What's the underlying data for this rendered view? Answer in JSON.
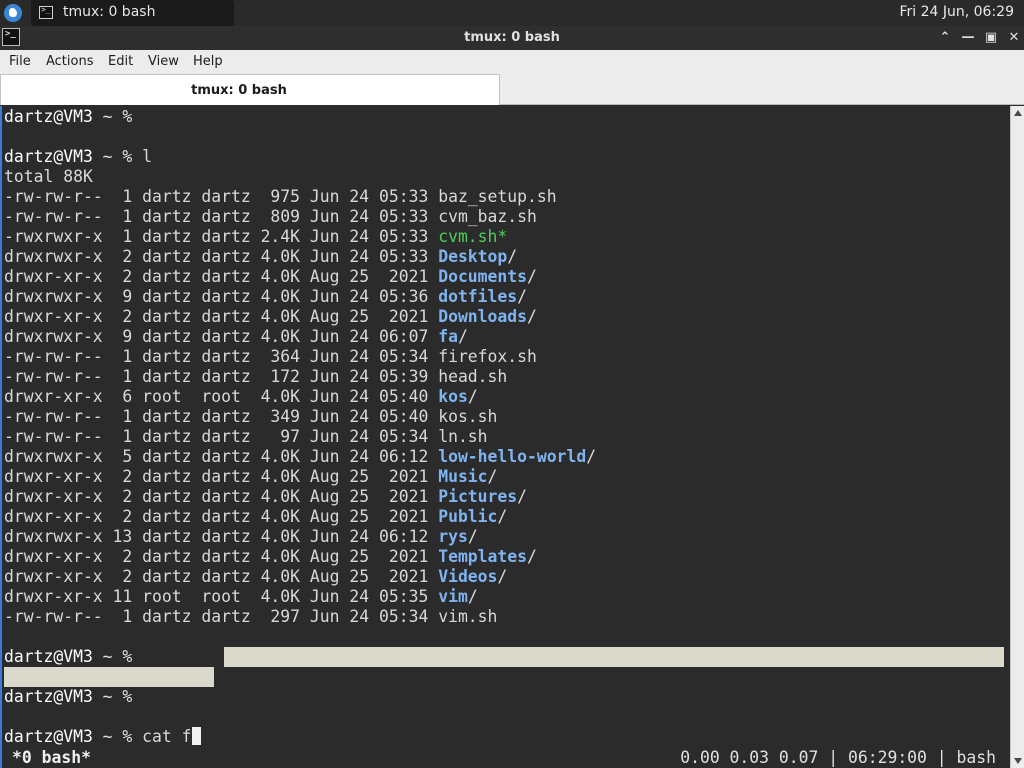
{
  "panel": {
    "task_label": "tmux: 0 bash",
    "clock": "Fri 24 Jun, 06:29"
  },
  "window": {
    "title": "tmux: 0 bash"
  },
  "menu": {
    "items": [
      "File",
      "Actions",
      "Edit",
      "View",
      "Help"
    ]
  },
  "tab": {
    "label": "tmux: 0 bash"
  },
  "terminal": {
    "prompt_host": "dartz@VM3",
    "prompt_suffix": " ~ % ",
    "commands": [
      "",
      "l",
      "",
      "",
      "cat f"
    ],
    "total": "total 88K",
    "listing": [
      {
        "meta": "-rw-rw-r--  1 dartz dartz  975 Jun 24 05:33 ",
        "name": "baz_setup.sh",
        "kind": "file"
      },
      {
        "meta": "-rw-rw-r--  1 dartz dartz  809 Jun 24 05:33 ",
        "name": "cvm_baz.sh",
        "kind": "file"
      },
      {
        "meta": "-rwxrwxr-x  1 dartz dartz 2.4K Jun 24 05:33 ",
        "name": "cvm.sh",
        "suffix": "*",
        "kind": "exe"
      },
      {
        "meta": "drwxrwxr-x  2 dartz dartz 4.0K Jun 24 05:33 ",
        "name": "Desktop",
        "suffix": "/",
        "kind": "dir"
      },
      {
        "meta": "drwxr-xr-x  2 dartz dartz 4.0K Aug 25  2021 ",
        "name": "Documents",
        "suffix": "/",
        "kind": "dir"
      },
      {
        "meta": "drwxrwxr-x  9 dartz dartz 4.0K Jun 24 05:36 ",
        "name": "dotfiles",
        "suffix": "/",
        "kind": "dir"
      },
      {
        "meta": "drwxr-xr-x  2 dartz dartz 4.0K Aug 25  2021 ",
        "name": "Downloads",
        "suffix": "/",
        "kind": "dir"
      },
      {
        "meta": "drwxrwxr-x  9 dartz dartz 4.0K Jun 24 06:07 ",
        "name": "fa",
        "suffix": "/",
        "kind": "dir"
      },
      {
        "meta": "-rw-rw-r--  1 dartz dartz  364 Jun 24 05:34 ",
        "name": "firefox.sh",
        "kind": "file"
      },
      {
        "meta": "-rw-rw-r--  1 dartz dartz  172 Jun 24 05:39 ",
        "name": "head.sh",
        "kind": "file"
      },
      {
        "meta": "drwxr-xr-x  6 root  root  4.0K Jun 24 05:40 ",
        "name": "kos",
        "suffix": "/",
        "kind": "dir"
      },
      {
        "meta": "-rw-rw-r--  1 dartz dartz  349 Jun 24 05:40 ",
        "name": "kos.sh",
        "kind": "file"
      },
      {
        "meta": "-rw-rw-r--  1 dartz dartz   97 Jun 24 05:34 ",
        "name": "ln.sh",
        "kind": "file"
      },
      {
        "meta": "drwxrwxr-x  5 dartz dartz 4.0K Jun 24 06:12 ",
        "name": "low-hello-world",
        "suffix": "/",
        "kind": "dir"
      },
      {
        "meta": "drwxr-xr-x  2 dartz dartz 4.0K Aug 25  2021 ",
        "name": "Music",
        "suffix": "/",
        "kind": "dir"
      },
      {
        "meta": "drwxr-xr-x  2 dartz dartz 4.0K Aug 25  2021 ",
        "name": "Pictures",
        "suffix": "/",
        "kind": "dir"
      },
      {
        "meta": "drwxr-xr-x  2 dartz dartz 4.0K Aug 25  2021 ",
        "name": "Public",
        "suffix": "/",
        "kind": "dir"
      },
      {
        "meta": "drwxrwxr-x 13 dartz dartz 4.0K Jun 24 06:12 ",
        "name": "rys",
        "suffix": "/",
        "kind": "dir"
      },
      {
        "meta": "drwxr-xr-x  2 dartz dartz 4.0K Aug 25  2021 ",
        "name": "Templates",
        "suffix": "/",
        "kind": "dir"
      },
      {
        "meta": "drwxr-xr-x  2 dartz dartz 4.0K Aug 25  2021 ",
        "name": "Videos",
        "suffix": "/",
        "kind": "dir"
      },
      {
        "meta": "drwxr-xr-x 11 root  root  4.0K Jun 24 05:35 ",
        "name": "vim",
        "suffix": "/",
        "kind": "dir"
      },
      {
        "meta": "-rw-rw-r--  1 dartz dartz  297 Jun 24 05:34 ",
        "name": "vim.sh",
        "kind": "file"
      }
    ]
  },
  "status": {
    "left": "*0 bash*",
    "right": "0.00 0.03 0.07 | 06:29:00 | bash"
  },
  "colors": {
    "terminal_bg": "#2b2b2b",
    "exe": "#4fcf5a",
    "dir": "#7fb4f0",
    "selection": "#dad9cb"
  }
}
